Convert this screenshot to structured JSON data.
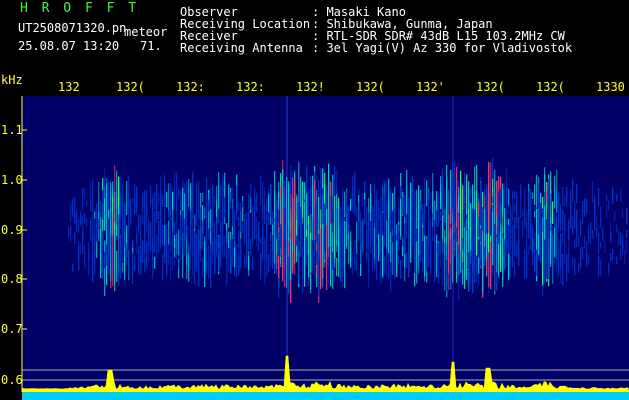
{
  "header": {
    "logo": "H R O F F T",
    "filename": "UT2508071320.pn",
    "type": "meteor",
    "timestamp": "25.08.07 13:20",
    "count": "71.",
    "fields": [
      {
        "label": "Observer",
        "value": "Masaki Kano"
      },
      {
        "label": "Receiving Location",
        "value": "Shibukawa, Gunma, Japan"
      },
      {
        "label": "Receiver",
        "value": "RTL-SDR SDR# 43dB L15 103.2MHz CW"
      },
      {
        "label": "Receiving Antenna",
        "value": "3el Yagi(V) Az 330 for Vladivostok"
      }
    ]
  },
  "axes": {
    "y_unit": "kHz",
    "y_ticks": [
      "1.1",
      "1.0",
      "0.9",
      "0.8",
      "0.7",
      "0.6"
    ],
    "x_ticks": [
      "132",
      "132(",
      "132:",
      "132:",
      "132!",
      "132(",
      "132'",
      "132(",
      "132(",
      "1330"
    ]
  },
  "colors": {
    "background": "#000000",
    "header_green": "#33ff33",
    "header_white": "#ffffff",
    "axis_yellow": "#ffff33",
    "plot_bg": "#000066",
    "signal_low": "#0033cc",
    "signal_mid": "#00cccc",
    "signal_high": "#ff3366",
    "power_trace": "#ffff00",
    "baseline_cyan": "#00ccff"
  }
}
